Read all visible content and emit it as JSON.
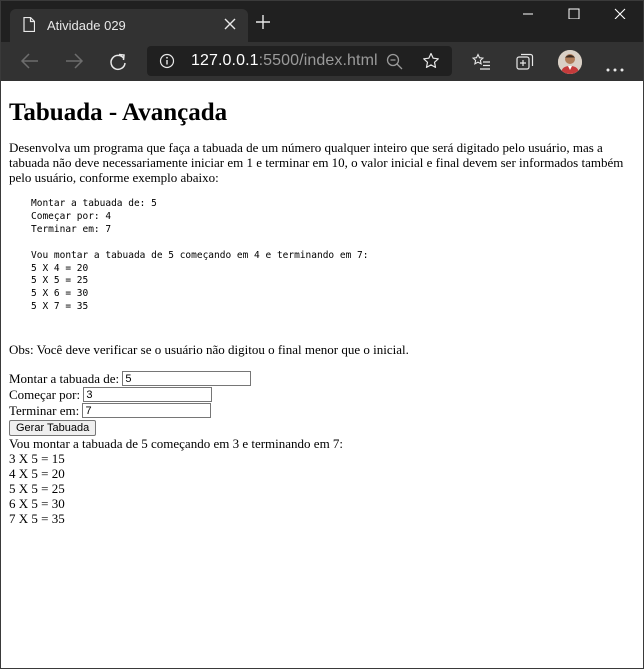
{
  "browser": {
    "tab_title": "Atividade 029",
    "url_host": "127.0.0.1",
    "url_rest": ":5500/index.html"
  },
  "page": {
    "heading": "Tabuada - Avançada",
    "description": "Desenvolva um programa que faça a tabuada de um número qualquer inteiro que será digitado pelo usuário, mas a tabuada não deve necessariamente iniciar em 1 e terminar em 10, o valor inicial e final devem ser informados também pelo usuário, conforme exemplo abaixo:",
    "example": "Montar a tabuada de: 5\nComeçar por: 4\nTerminar em: 7\n\nVou montar a tabuada de 5 começando em 4 e terminando em 7:\n5 X 4 = 20\n5 X 5 = 25\n5 X 6 = 30\n5 X 7 = 35",
    "obs": "Obs: Você deve verificar se o usuário não digitou o final menor que o inicial."
  },
  "form": {
    "label_numero": "Montar a tabuada de:",
    "value_numero": "5",
    "label_inicio": "Começar por:",
    "value_inicio": "3",
    "label_fim": "Terminar em:",
    "value_fim": "7",
    "button_label": "Gerar Tabuada"
  },
  "result": {
    "header": "Vou montar a tabuada de 5 começando em 3 e terminando em 7:",
    "lines": [
      "3 X 5 = 15",
      "4 X 5 = 20",
      "5 X 5 = 25",
      "6 X 5 = 30",
      "7 X 5 = 35"
    ]
  }
}
